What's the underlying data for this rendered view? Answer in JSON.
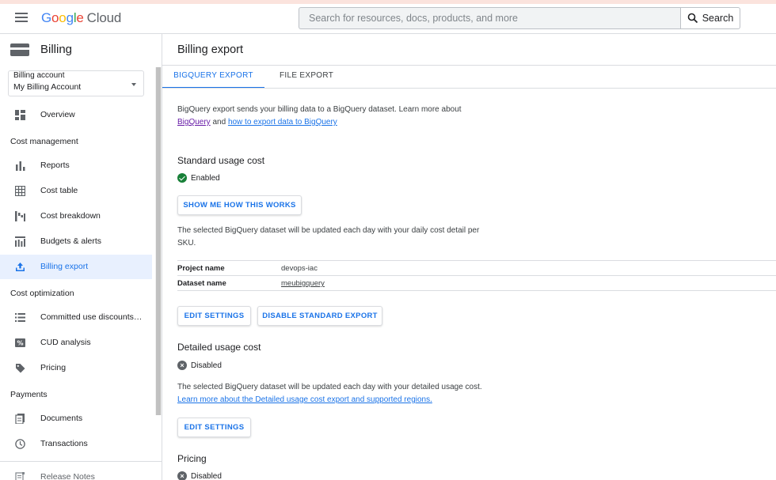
{
  "header": {
    "brand_logo": "Google Cloud",
    "search_placeholder": "Search for resources, docs, products, and more",
    "search_button_label": "Search"
  },
  "sidebar": {
    "title": "Billing",
    "billing_account": {
      "label": "Billing account",
      "value": "My Billing Account"
    },
    "overview": "Overview",
    "section_cost_management": "Cost management",
    "reports": "Reports",
    "cost_table": "Cost table",
    "cost_breakdown": "Cost breakdown",
    "budgets_alerts": "Budgets & alerts",
    "billing_export": "Billing export",
    "section_cost_optimization": "Cost optimization",
    "committed_use": "Committed use discounts…",
    "cud_analysis": "CUD analysis",
    "pricing": "Pricing",
    "section_payments": "Payments",
    "documents": "Documents",
    "transactions": "Transactions",
    "release_notes": "Release Notes"
  },
  "main": {
    "page_title": "Billing export",
    "tabs": {
      "bigquery": "BIGQUERY EXPORT",
      "file": "FILE EXPORT"
    },
    "intro_text": "BigQuery export sends your billing data to a BigQuery dataset. Learn more about",
    "intro_link_bigquery": "BigQuery",
    "intro_and": "and",
    "intro_link_howto": "how to export data to BigQuery",
    "standard": {
      "title": "Standard usage cost",
      "status": "Enabled",
      "show_me_button": "SHOW ME HOW THIS WORKS",
      "description_line1": "The selected BigQuery dataset will be updated each day with your daily cost detail per",
      "description_line2": "SKU.",
      "project_name_key": "Project name",
      "project_name_value": "devops-iac",
      "dataset_name_key": "Dataset name",
      "dataset_name_value": "meubigquery",
      "edit_button": "EDIT SETTINGS",
      "disable_button": "DISABLE STANDARD EXPORT"
    },
    "detailed": {
      "title": "Detailed usage cost",
      "status": "Disabled",
      "description": "The selected BigQuery dataset will be updated each day with your detailed usage cost.",
      "learn_more_link": "Learn more about the Detailed usage cost export and supported regions.",
      "edit_button": "EDIT SETTINGS"
    },
    "pricing": {
      "title": "Pricing",
      "status": "Disabled"
    }
  },
  "colors": {
    "accent": "#1a73e8",
    "active_nav_bg": "#e8f0fe",
    "enabled_green": "#188038",
    "visited_link": "#681da8"
  }
}
